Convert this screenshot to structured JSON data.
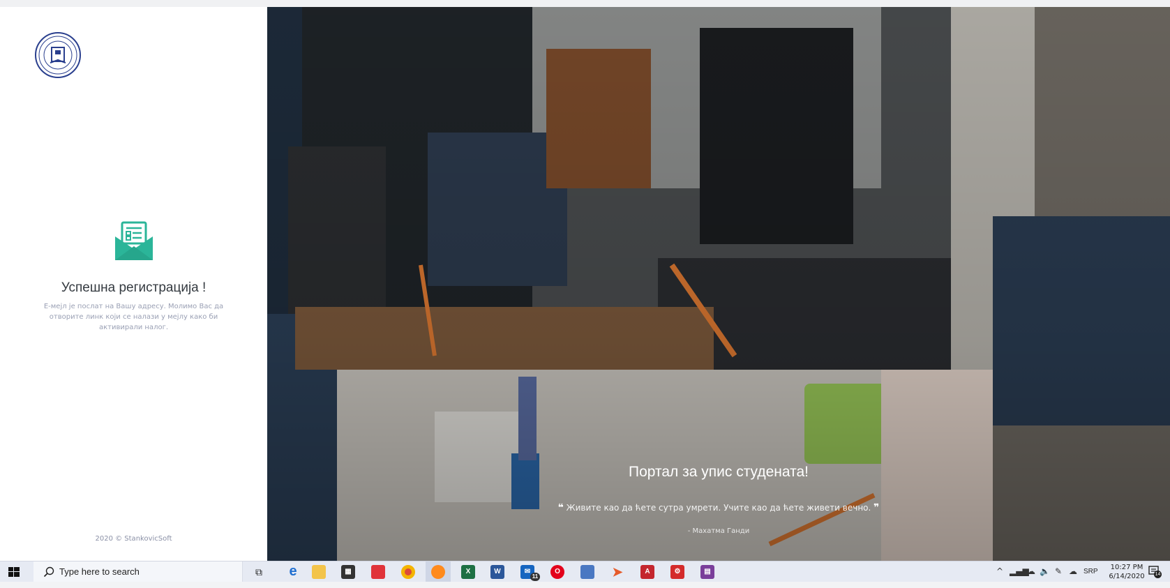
{
  "left_panel": {
    "logo": "university-seal",
    "message_icon": "mail-document-icon",
    "title": "Успешна регистрација !",
    "text": "Е-мејл је послат на Вашу адресу. Молимо Вас да отворите линк који се налази у мејлу како би активирали налог.",
    "copyright": "2020 © StankovicSoft"
  },
  "hero": {
    "title": "Портал за упис студената!",
    "quote": "Живите као да ћете сутра умрети. Учите као да ћете живети вечно.",
    "author": "- Махатма Ганди"
  },
  "taskbar": {
    "search_placeholder": "Type here to search",
    "language": "SRP",
    "time": "10:27 PM",
    "date": "6/14/2020",
    "mail_badge": "11",
    "notification_count": "14",
    "pinned_apps": [
      "task-view",
      "edge",
      "file-explorer",
      "store",
      "app-red",
      "chrome",
      "firefox",
      "excel",
      "word",
      "mail",
      "opera",
      "app-blue",
      "app-orange",
      "acrobat",
      "app-gear",
      "winrar"
    ]
  },
  "colors": {
    "accent": "#2bb599",
    "title_text": "#343a40",
    "muted_text": "#9aa0b4",
    "taskbar_bg": "#e6eaf3"
  }
}
